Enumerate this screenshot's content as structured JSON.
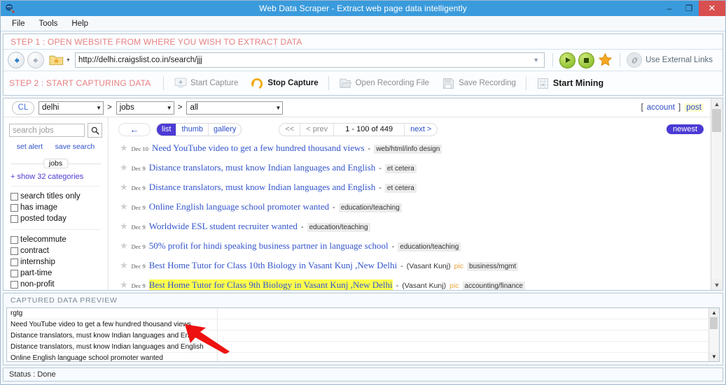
{
  "window": {
    "title": "Web Data Scraper -  Extract web page data intelligently",
    "app_icon": "magnifier-globe-icon",
    "minimize": "–",
    "restore": "❐",
    "close": "✕"
  },
  "menu": {
    "items": [
      "File",
      "Tools",
      "Help"
    ]
  },
  "step1": {
    "label": "STEP 1 : OPEN WEBSITE FROM WHERE YOU WISH TO EXTRACT DATA",
    "back_icon": "back-arrow-icon",
    "forward_icon": "forward-arrow-icon",
    "favorites_icon": "favorites-folder-icon",
    "url": "http://delhi.craigslist.co.in/search/jjj",
    "url_dropdown_icon": "chevron-down-icon",
    "play_icon": "play-icon",
    "stop_icon": "stop-icon",
    "star_icon": "star-icon",
    "chain_icon": "chain-link-icon",
    "external_links_label": "Use External Links"
  },
  "step2": {
    "label": "STEP 2 : START CAPTURING DATA",
    "buttons": [
      {
        "label": "Start Capture",
        "icon": "start-capture-icon",
        "state": "disabled"
      },
      {
        "label": "Stop Capture",
        "icon": "stop-capture-icon",
        "state": "enabled"
      },
      {
        "label": "Open Recording File",
        "icon": "open-file-icon",
        "state": "disabled"
      },
      {
        "label": "Save Recording",
        "icon": "save-icon",
        "state": "disabled"
      },
      {
        "label": "Start Mining",
        "icon": "mining-grid-icon",
        "state": "enabled"
      }
    ]
  },
  "browser": {
    "header": {
      "logo": "CL",
      "selects": [
        {
          "value": "delhi"
        },
        {
          "value": "jobs"
        },
        {
          "value": "all"
        }
      ],
      "separator": ">",
      "account_open_bracket": "[",
      "account_label": "account",
      "account_close_bracket": "]",
      "post_label": "post"
    },
    "sidebar": {
      "search_placeholder": "search jobs",
      "search_icon": "search-icon",
      "set_alert": "set alert",
      "save_search": "save search",
      "section_chip": "jobs",
      "show_categories": "+ show 32 categories",
      "filters_group_1": [
        "search titles only",
        "has image",
        "posted today"
      ],
      "filters_group_2": [
        "telecommute",
        "contract",
        "internship",
        "part-time",
        "non-profit"
      ]
    },
    "toolbar": {
      "back_arrow": "←",
      "views": [
        "list",
        "thumb",
        "gallery"
      ],
      "active_view": "list",
      "pager": {
        "first": "<<",
        "prev": "< prev",
        "count": "1 - 100 of 449",
        "next": "next >"
      },
      "sort_label": "newest"
    },
    "listings": [
      {
        "date": "Dec 10",
        "title": "Need YouTube video to get a few hundred thousand views",
        "dash": "-",
        "hood": "",
        "pic": "",
        "category": "web/html/info design",
        "highlight": false
      },
      {
        "date": "Dec 9",
        "title": "Distance translators, must know Indian languages and English",
        "dash": "-",
        "hood": "",
        "pic": "",
        "category": "et cetera",
        "highlight": false
      },
      {
        "date": "Dec 9",
        "title": "Distance translators, must know Indian languages and English",
        "dash": "-",
        "hood": "",
        "pic": "",
        "category": "et cetera",
        "highlight": false
      },
      {
        "date": "Dec 9",
        "title": "Online English language school promoter wanted",
        "dash": "-",
        "hood": "",
        "pic": "",
        "category": "education/teaching",
        "highlight": false
      },
      {
        "date": "Dec 9",
        "title": "Worldwide ESL student recruiter wanted",
        "dash": "-",
        "hood": "",
        "pic": "",
        "category": "education/teaching",
        "highlight": false
      },
      {
        "date": "Dec 9",
        "title": "50% profit for hindi speaking business partner in language school",
        "dash": "-",
        "hood": "",
        "pic": "",
        "category": "education/teaching",
        "highlight": false
      },
      {
        "date": "Dec 9",
        "title": "Best Home Tutor for Class 10th Biology in Vasant Kunj ,New Delhi",
        "dash": "-",
        "hood": "(Vasant Kunj)",
        "pic": "pic",
        "category": "business/mgmt",
        "highlight": false
      },
      {
        "date": "Dec 9",
        "title": "Best Home Tutor for Class 9th Biology in Vasant Kunj ,New Delhi",
        "dash": "-",
        "hood": "(Vasant Kunj)",
        "pic": "pic",
        "category": "accounting/finance",
        "highlight": true
      }
    ],
    "scrollbar": {
      "up_icon": "chevron-up-icon",
      "down_icon": "chevron-down-icon"
    }
  },
  "captured": {
    "header": "CAPTURED DATA PREVIEW",
    "rows": [
      "rgtg",
      "Need YouTube video to get a few hundred thousand views",
      "Distance translators, must know Indian languages and English",
      "Distance translators, must know Indian languages and English",
      "Online English language school promoter wanted"
    ],
    "scrollbar": {
      "up_icon": "chevron-up-icon",
      "down_icon": "chevron-down-icon"
    }
  },
  "statusbar": {
    "text": "Status :  Done"
  },
  "annotation": {
    "arrow": "red-pointer-arrow"
  },
  "colors": {
    "titlebar": "#3a9bdc",
    "step_text": "#e98080",
    "link": "#2d4ec8",
    "accent_purple": "#4b3bd4",
    "highlight": "#ffff4d",
    "close_button": "#d94f4f"
  }
}
